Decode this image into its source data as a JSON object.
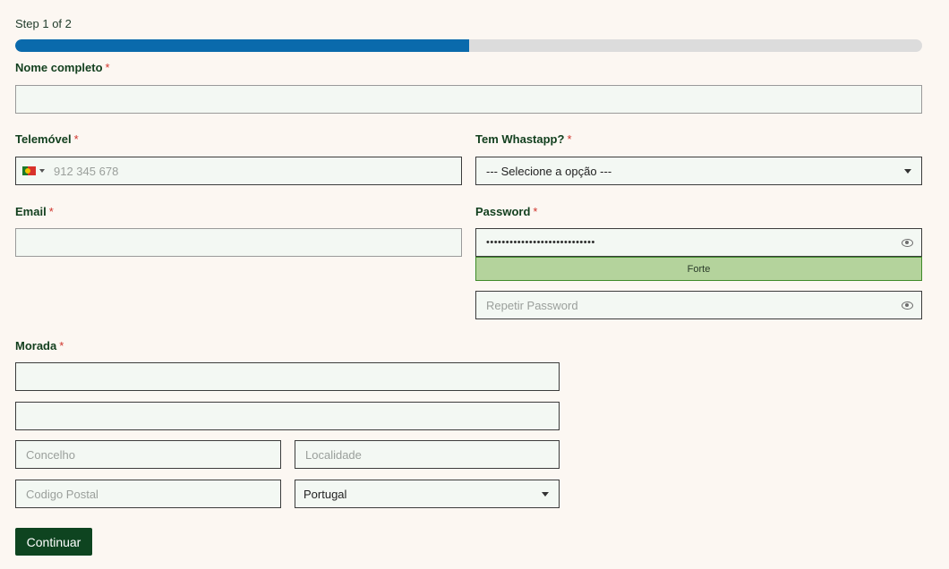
{
  "step": {
    "text": "Step 1 of 2",
    "progress_fraction": 0.5
  },
  "form": {
    "nome": {
      "label": "Nome completo",
      "required_mark": "*",
      "value": ""
    },
    "telemovel": {
      "label": "Telemóvel",
      "required_mark": "*",
      "placeholder": "912 345 678",
      "country": "Portugal flag"
    },
    "whatsapp": {
      "label": "Tem Whastapp?",
      "required_mark": "*",
      "selected": "--- Selecione a opção ---"
    },
    "email": {
      "label": "Email",
      "required_mark": "*",
      "value": ""
    },
    "password": {
      "label": "Password",
      "required_mark": "*",
      "value": "••••••••••••••••••••••••••••",
      "strength": "Forte",
      "strength_color": "#b4d39c"
    },
    "repeat_password": {
      "placeholder": "Repetir Password"
    },
    "morada": {
      "label": "Morada",
      "required_mark": "*",
      "line1": "",
      "line2": "",
      "concelho_placeholder": "Concelho",
      "localidade_placeholder": "Localidade",
      "codigo_postal_placeholder": "Codigo Postal",
      "pais_selected": "Portugal"
    },
    "submit_label": "Continuar"
  },
  "colors": {
    "progress": "#0a6aac",
    "button": "#0e4420",
    "label": "#13401f",
    "required": "#d0342c",
    "background": "#fcf7f2"
  }
}
